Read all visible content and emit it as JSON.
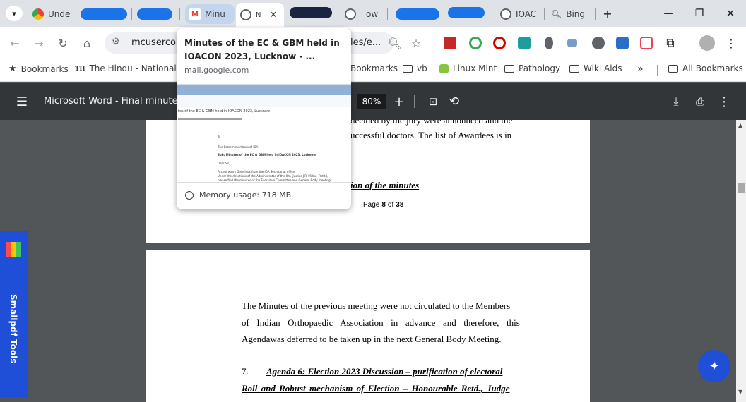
{
  "tabs": [
    {
      "label": "Unde",
      "favicon": "chrome-icon"
    },
    {
      "label": "Minu",
      "favicon": "gmail-icon"
    },
    {
      "label": "N",
      "favicon": "globe-icon",
      "active": true
    },
    {
      "label": "ow",
      "favicon": "globe-icon"
    },
    {
      "label": "IOAC",
      "favicon": "globe-icon"
    },
    {
      "label": "Bing",
      "favicon": "search-icon"
    }
  ],
  "window": {
    "minimize": "—",
    "restore": "❐",
    "close": "✕"
  },
  "address": {
    "url_start": "mcusercon",
    "url_end": "les/e..."
  },
  "bookmarks": [
    {
      "label": "Bookmarks",
      "icon": "star-icon"
    },
    {
      "label": "The Hindu - National",
      "icon": "th-icon"
    },
    {
      "label": "Bookmarks",
      "icon": "folder-icon"
    },
    {
      "label": "vb",
      "icon": "folder-icon"
    },
    {
      "label": "Linux Mint",
      "icon": "mint-icon"
    },
    {
      "label": "Pathology",
      "icon": "folder-icon"
    },
    {
      "label": "Wiki Aids",
      "icon": "folder-icon"
    },
    {
      "label": "»",
      "icon": ""
    },
    {
      "label": "All Bookmarks",
      "icon": "folder-icon"
    }
  ],
  "pdf": {
    "title": "Microsoft Word - Final minutes",
    "zoom": "80%",
    "page_label": "Page",
    "page_current": "8",
    "page_of": "of",
    "page_total": "38"
  },
  "page1": {
    "line_top": "decided by the jury were announced and the",
    "line1": "uccessful doctors. The list of Awardees is in",
    "heading": "ion of the minutes"
  },
  "page2": {
    "p1": "The Minutes of the previous meeting were not circulated to the Members",
    "p2": "of Indian Orthopaedic Association in advance and therefore, this",
    "p3": "Agendawas deferred to be taken up in the next General Body Meeting.",
    "item_num": "7.",
    "item_l1": "Agenda 6: Election 2023 Discussion – purification of electoral",
    "item_l2": "Roll and Robust mechanism of Election – Honourable Retd., Judge"
  },
  "hovercard": {
    "title": "Minutes of the EC & GBM held in IOACON 2023, Lucknow - ...",
    "domain": "mail.google.com",
    "memory": "Memory usage: 718 MB",
    "thumb_subject": "tes of the EC & GBM held in IOACON 2023, Lucknow",
    "thumb_to": "To",
    "thumb_members": "The Esteem members of IOA",
    "thumb_sub": "Sub: Minutes of the EC & GBM held in IOACON 2023, Lucknow",
    "thumb_dear": "Dear Sir,",
    "thumb_l1": "Accept warm Greetings from the IOA Secretariat office!",
    "thumb_l2": "Under the directions of the Administrator of the IOA (Justice J.R. Midha- Retd.),",
    "thumb_l3": "please find the minutes of the Executive Committee and General Body meetings"
  },
  "smallpdf": {
    "label": "Smallpdf Tools"
  },
  "colors": {
    "accent": "#1a73e8",
    "smallpdf": "#1e4fd6",
    "pdfbar": "#323639"
  }
}
